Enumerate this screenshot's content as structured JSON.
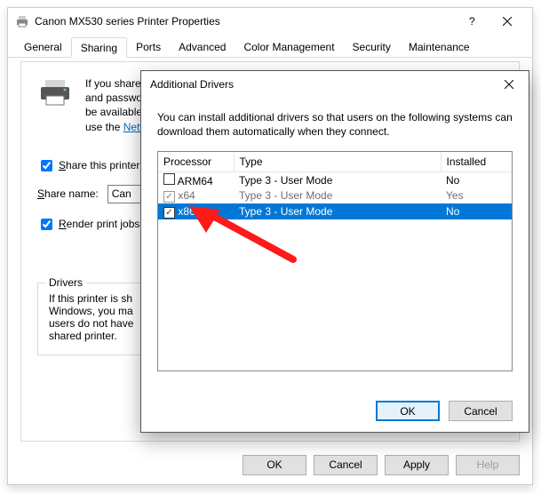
{
  "parent": {
    "title": "Canon MX530 series Printer Properties",
    "tabs": [
      "General",
      "Sharing",
      "Ports",
      "Advanced",
      "Color Management",
      "Security",
      "Maintenance"
    ],
    "activeTab": 1,
    "intro": {
      "l1": "If you share th",
      "l2": "and password",
      "l3": "be available w",
      "l4": "use the ",
      "link": "Netwo"
    },
    "shareCheck": {
      "prefix": "S",
      "rest": "hare this printer"
    },
    "shareName": {
      "label_prefix": "S",
      "label_rest": "hare name:",
      "value": "Can"
    },
    "render": {
      "prefix": "R",
      "rest": "ender print jobs"
    },
    "drivers": {
      "title": "Drivers",
      "l1": "If this printer is sh",
      "l2": "Windows, you ma",
      "l3": "users do not have",
      "l4": "shared printer."
    },
    "buttons": {
      "ok": "OK",
      "cancel": "Cancel",
      "apply": "Apply",
      "help": "Help"
    }
  },
  "child": {
    "title": "Additional Drivers",
    "msg": "You can install additional drivers so that users on the following systems can download them automatically when they connect.",
    "columns": {
      "proc": "Processor",
      "type": "Type",
      "inst": "Installed"
    },
    "rows": [
      {
        "checked": false,
        "proc": "ARM64",
        "type": "Type 3 - User Mode",
        "inst": "No",
        "state": ""
      },
      {
        "checked": true,
        "proc": "x64",
        "type": "Type 3 - User Mode",
        "inst": "Yes",
        "state": "dim"
      },
      {
        "checked": true,
        "proc": "x86",
        "type": "Type 3 - User Mode",
        "inst": "No",
        "state": "sel"
      }
    ],
    "ok": "OK",
    "cancel": "Cancel"
  }
}
